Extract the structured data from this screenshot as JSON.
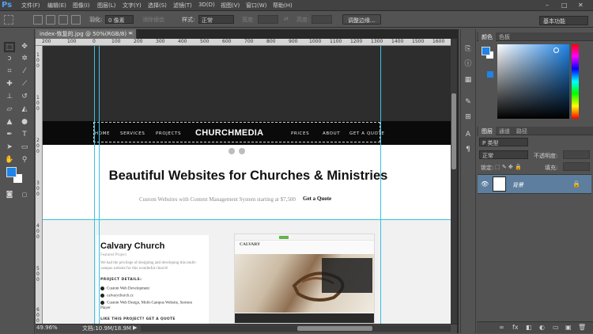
{
  "app": {
    "logo": "Ps",
    "menu": [
      "文件(F)",
      "编辑(E)",
      "图像(I)",
      "图层(L)",
      "文字(Y)",
      "选择(S)",
      "滤镜(T)",
      "3D(D)",
      "视图(V)",
      "窗口(W)",
      "帮助(H)"
    ],
    "window_controls": [
      "–",
      "□",
      "✕"
    ]
  },
  "options": {
    "feather_label": "羽化:",
    "feather_value": "0 像素",
    "antialias_label": "消除锯齿",
    "style_label": "样式:",
    "style_value": "正常",
    "width_label": "宽度:",
    "height_label": "高度:",
    "refine_edge": "调整边缘...",
    "workspace": "基本功能"
  },
  "document": {
    "tab_title": "index-恢复的.jpg @ 50%(RGB/8) *",
    "close": "×",
    "ruler_top": [
      "200",
      "100",
      "0",
      "100",
      "200",
      "300",
      "400",
      "500",
      "600",
      "700",
      "800",
      "900",
      "1000",
      "1100",
      "1200",
      "1300",
      "1400",
      "1500",
      "1600",
      "1700",
      "1800",
      "1900"
    ],
    "ruler_left": [
      "1",
      "0",
      "0",
      "1",
      "0",
      "0",
      "2",
      "0",
      "0",
      "3",
      "0",
      "0",
      "4",
      "0",
      "0",
      "5",
      "0",
      "0",
      "6",
      "0",
      "0"
    ]
  },
  "webpage": {
    "nav_items": [
      "HOME",
      "SERVICES",
      "PROJECTS",
      "PRICES",
      "ABOUT",
      "GET A QUOTE"
    ],
    "logo": "CHURCHMEDIA",
    "headline": "Beautiful Websites for Churches & Ministries",
    "subline": "Custom Websites with Content Management System starting at $7,500",
    "quote_link": "Get a Quote",
    "project": {
      "title": "Calvary Church",
      "subtitle": "Featured Project",
      "description": "We had the privilege of designing and developing this multi-campus website for this wonderful church!",
      "details_heading": "PROJECT DETAILS:",
      "items": [
        "Custom Web Development",
        "calvarychurch.cc",
        "Custom Web Design, Multi-Campus Website, Sermon Player"
      ],
      "like_line": "LIKE THIS PROJECT? GET A QUOTE"
    },
    "preview_logo": "CALVARY"
  },
  "status": {
    "zoom": "49.96%",
    "doc_info": "文档:10.9M/18.9M",
    "arrow": "▶"
  },
  "panels": {
    "color_tabs": [
      "颜色",
      "色板"
    ],
    "layer_tabs": [
      "图层",
      "通道",
      "路径"
    ],
    "kind_label": "P 类型",
    "blend_mode": "正常",
    "opacity_label": "不透明度:",
    "lock_label": "锁定:",
    "fill_label": "填充:",
    "layer_name": "背景",
    "footer_icons": [
      "∞",
      "fx",
      "◧",
      "◐",
      "▭",
      "▣",
      "🗑"
    ]
  },
  "colors": {
    "foreground": "#1e84e8",
    "background": "#ffffff",
    "guide": "#39c2e0",
    "selected_layer": "#5d7e9e"
  }
}
